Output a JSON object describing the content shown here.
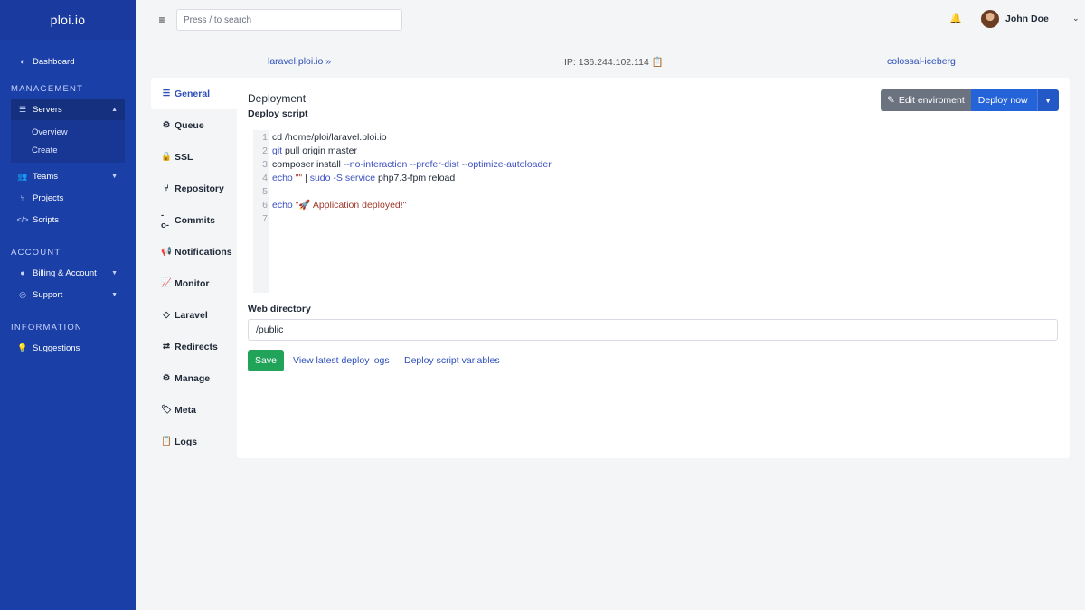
{
  "brand": "ploi.io",
  "sidebar": {
    "dashboard": "Dashboard",
    "management_title": "MANAGEMENT",
    "servers": "Servers",
    "servers_sub": [
      "Overview",
      "Create"
    ],
    "teams": "Teams",
    "projects": "Projects",
    "scripts": "Scripts",
    "account_title": "ACCOUNT",
    "billing": "Billing & Account",
    "support": "Support",
    "information_title": "INFORMATION",
    "suggestions": "Suggestions"
  },
  "topbar": {
    "search_placeholder": "Press / to search",
    "user_name": "John Doe"
  },
  "infobar": {
    "site": "laravel.ploi.io",
    "ip_label": "IP: 136.244.102.114",
    "server": "colossal-iceberg"
  },
  "tabs": [
    "General",
    "Queue",
    "SSL",
    "Repository",
    "Commits",
    "Notifications",
    "Monitor",
    "Laravel",
    "Redirects",
    "Manage",
    "Meta",
    "Logs"
  ],
  "panel": {
    "title": "Deployment",
    "subtitle": "Deploy script",
    "edit_env": "Edit enviroment",
    "deploy_now": "Deploy now",
    "line_numbers": [
      "1",
      "2",
      "3",
      "4",
      "5",
      "6",
      "7"
    ],
    "code": {
      "l1": "cd /home/ploi/laravel.ploi.io",
      "l2_kw": "git",
      "l2_rest": " pull origin master",
      "l3_a": "composer install ",
      "l3_b": "--no-interaction --prefer-dist --optimize-autoloader",
      "l4_a": "echo",
      "l4_b": " \"\"",
      "l4_c": " | ",
      "l4_d": "sudo -S service",
      "l4_e": " php7.3-fpm reload",
      "l6_a": "echo",
      "l6_b": " \"🚀 Application deployed!\""
    },
    "web_dir_label": "Web directory",
    "web_dir_value": "/public",
    "save": "Save",
    "view_logs": "View latest deploy logs",
    "script_vars": "Deploy script variables"
  }
}
